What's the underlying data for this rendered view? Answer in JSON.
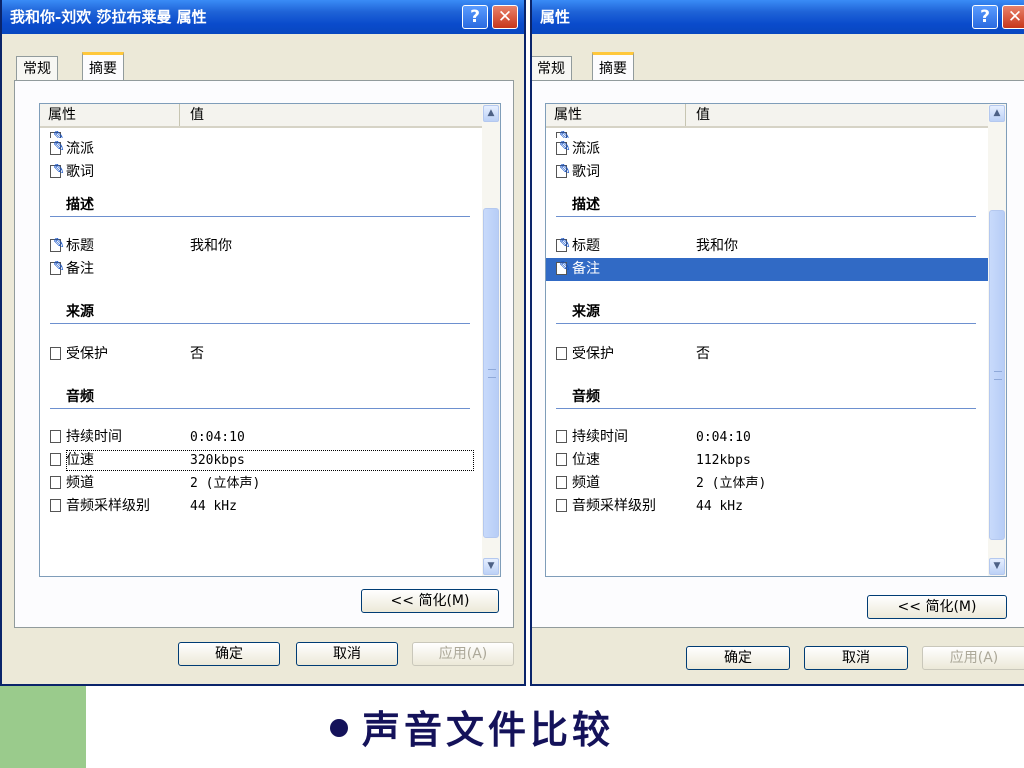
{
  "left_window": {
    "title": "我和你-刘欢 莎拉布莱曼 属性",
    "help_icon": "?",
    "close_icon": "✕",
    "tabs": [
      "常规",
      "摘要"
    ],
    "columns": {
      "property": "属性",
      "value": "值"
    },
    "rows": [
      {
        "name": "流派",
        "value": ""
      },
      {
        "name": "歌词",
        "value": ""
      }
    ],
    "groups": {
      "describe": "描述",
      "source": "来源",
      "audio": "音频"
    },
    "describe_rows": [
      {
        "name": "标题",
        "value": "我和你"
      },
      {
        "name": "备注",
        "value": ""
      }
    ],
    "source_rows": [
      {
        "name": "受保护",
        "value": "否"
      }
    ],
    "audio_rows": [
      {
        "name": "持续时间",
        "value": "0:04:10"
      },
      {
        "name": "位速",
        "value": "320kbps"
      },
      {
        "name": "频道",
        "value": "2 (立体声)"
      },
      {
        "name": "音频采样级别",
        "value": "44 kHz"
      }
    ],
    "simplify_button": "<< 简化(M)",
    "ok_button": "确定",
    "cancel_button": "取消",
    "apply_button": "应用(A)"
  },
  "right_window": {
    "title": "属性",
    "help_icon": "?",
    "close_icon": "✕",
    "tabs": [
      "常规",
      "摘要"
    ],
    "columns": {
      "property": "属性",
      "value": "值"
    },
    "rows": [
      {
        "name": "流派",
        "value": ""
      },
      {
        "name": "歌词",
        "value": ""
      }
    ],
    "groups": {
      "describe": "描述",
      "source": "来源",
      "audio": "音频"
    },
    "describe_rows": [
      {
        "name": "标题",
        "value": "我和你"
      },
      {
        "name": "备注",
        "value": ""
      }
    ],
    "source_rows": [
      {
        "name": "受保护",
        "value": "否"
      }
    ],
    "audio_rows": [
      {
        "name": "持续时间",
        "value": "0:04:10"
      },
      {
        "name": "位速",
        "value": "112kbps"
      },
      {
        "name": "频道",
        "value": "2 (立体声)"
      },
      {
        "name": "音频采样级别",
        "value": "44 kHz"
      }
    ],
    "simplify_button": "<< 简化(M)",
    "ok_button": "确定",
    "cancel_button": "取消",
    "apply_button": "应用(A)"
  },
  "caption": "声音文件比较",
  "colors": {
    "titlebar": "#0a4bcc",
    "dialog_bg": "#ece9d8",
    "selection": "#316ac5",
    "caption_text": "#14125a",
    "side_block": "#9acb8c"
  }
}
